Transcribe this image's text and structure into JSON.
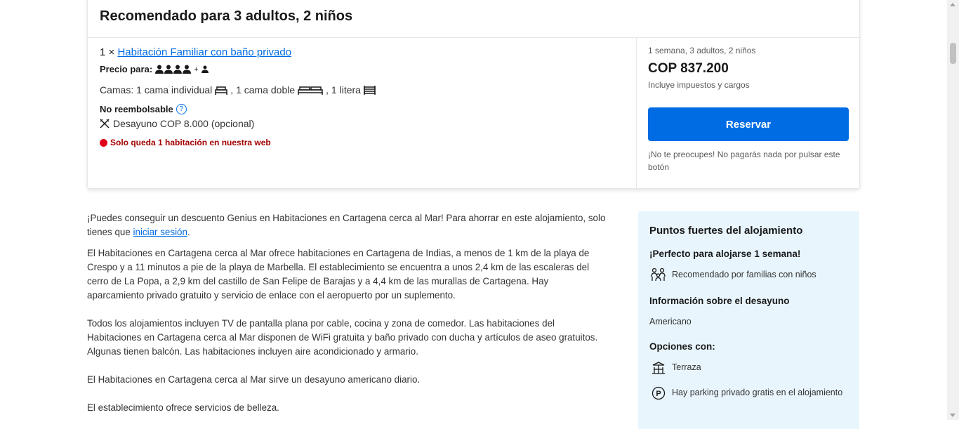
{
  "recommendation": {
    "title": "Recomendado para 3 adultos, 2 niños",
    "room_qty": "1 ×",
    "room_name": "Habitación Familiar con baño privado",
    "price_for_label": "Precio para:",
    "persons_plus": "+",
    "beds_prefix": "Camas: 1 cama individual",
    "beds_mid1": ", 1 cama doble",
    "beds_mid2": ", 1 litera",
    "non_refundable": "No reembolsable",
    "breakfast": "Desayuno COP 8.000 (opcional)",
    "scarcity": "Solo queda 1 habitación en nuestra web",
    "price_subtitle": "1 semana, 3 adultos, 2 niños",
    "price": "COP 837.200",
    "taxes": "Incluye impuestos y cargos",
    "reserve_label": "Reservar",
    "reassurance": "¡No te preocupes! No pagarás nada por pulsar este botón",
    "adults_icons": 4,
    "children_icons": 1
  },
  "description": {
    "genius_text": "¡Puedes conseguir un descuento Genius en Habitaciones en Cartagena cerca al Mar! Para ahorrar en este alojamiento, solo tienes que",
    "genius_link": "iniciar sesión",
    "genius_end": ".",
    "p1": "El Habitaciones en Cartagena cerca al Mar ofrece habitaciones en Cartagena de Indias, a menos de 1 km de la playa de Crespo y a 11 minutos a pie de la playa de Marbella. El establecimiento se encuentra a unos 2,4 km de las escaleras del cerro de La Popa, a 2,9 km del castillo de San Felipe de Barajas y a 4,4 km de las murallas de Cartagena. Hay aparcamiento privado gratuito y servicio de enlace con el aeropuerto por un suplemento.",
    "p2": "Todos los alojamientos incluyen TV de pantalla plana por cable, cocina y zona de comedor. Las habitaciones del Habitaciones en Cartagena cerca al Mar disponen de WiFi gratuita y baño privado con ducha y artículos de aseo gratuitos. Algunas tienen balcón. Las habitaciones incluyen aire acondicionado y armario.",
    "p3": "El Habitaciones en Cartagena cerca al Mar sirve un desayuno americano diario.",
    "p4": "El establecimiento ofrece servicios de belleza."
  },
  "highlights": {
    "title": "Puntos fuertes del alojamiento",
    "stay_title": "¡Perfecto para alojarse 1 semana!",
    "family_item": "Recomendado por familias con niños",
    "breakfast_title": "Información sobre el desayuno",
    "breakfast_value": "Americano",
    "options_title": "Opciones con:",
    "terrace": "Terraza",
    "parking": "Hay parking privado gratis en el alojamiento"
  },
  "colors": {
    "primary_blue": "#006ce4",
    "scarcity_red": "#a30000",
    "highlights_bg": "#e8f5fd"
  }
}
